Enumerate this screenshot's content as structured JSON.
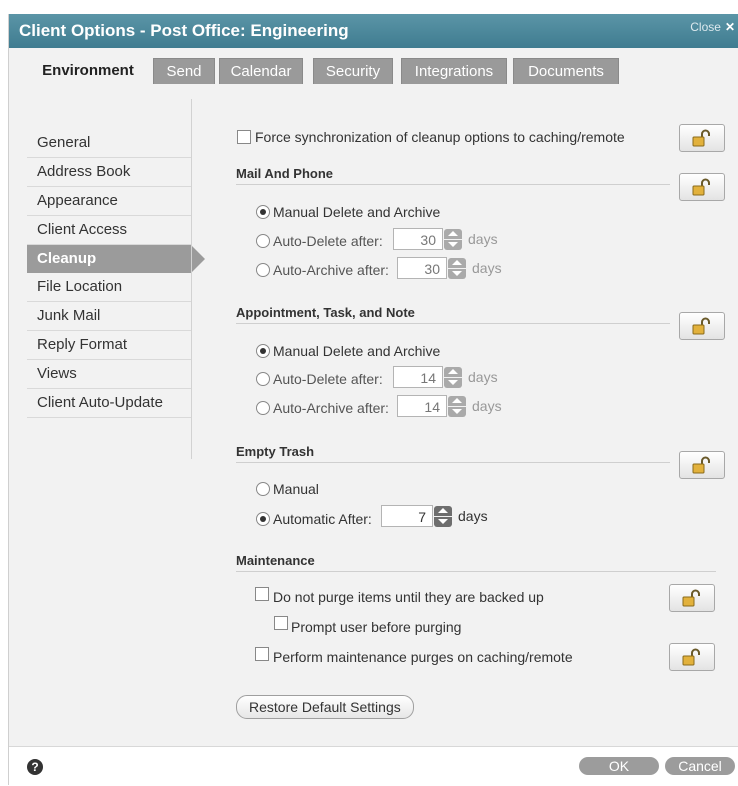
{
  "window": {
    "title": "Client Options - Post Office: Engineering",
    "close_label": "Close",
    "close_glyph": "✕"
  },
  "tabs": [
    {
      "label": "Environment",
      "active": true
    },
    {
      "label": "Send"
    },
    {
      "label": "Calendar"
    },
    {
      "label": "Security"
    },
    {
      "label": "Integrations"
    },
    {
      "label": "Documents"
    }
  ],
  "sidebar": {
    "items": [
      {
        "label": "General"
      },
      {
        "label": "Address Book"
      },
      {
        "label": "Appearance"
      },
      {
        "label": "Client Access"
      },
      {
        "label": "Cleanup",
        "active": true
      },
      {
        "label": "File Location"
      },
      {
        "label": "Junk Mail"
      },
      {
        "label": "Reply Format"
      },
      {
        "label": "Views"
      },
      {
        "label": "Client Auto-Update"
      }
    ]
  },
  "cleanup": {
    "force_sync": {
      "label": "Force synchronization of cleanup options to caching/remote",
      "checked": false
    },
    "mail_phone": {
      "heading": "Mail And Phone",
      "manual": {
        "label": "Manual Delete and Archive",
        "selected": true
      },
      "auto_delete": {
        "label": "Auto-Delete after:",
        "value": "30",
        "unit": "days",
        "selected": false
      },
      "auto_archive": {
        "label": "Auto-Archive after:",
        "value": "30",
        "unit": "days",
        "selected": false
      }
    },
    "appointment": {
      "heading": "Appointment, Task, and Note",
      "manual": {
        "label": "Manual Delete and Archive",
        "selected": true
      },
      "auto_delete": {
        "label": "Auto-Delete after:",
        "value": "14",
        "unit": "days",
        "selected": false
      },
      "auto_archive": {
        "label": "Auto-Archive after:",
        "value": "14",
        "unit": "days",
        "selected": false
      }
    },
    "trash": {
      "heading": "Empty Trash",
      "manual": {
        "label": "Manual",
        "selected": false
      },
      "automatic": {
        "label": "Automatic After:",
        "value": "7",
        "unit": "days",
        "selected": true
      }
    },
    "maintenance": {
      "heading": "Maintenance",
      "no_purge": {
        "label": "Do not purge items until they are backed up",
        "checked": false
      },
      "prompt": {
        "label": "Prompt user before purging",
        "checked": false
      },
      "perform": {
        "label": "Perform maintenance purges on caching/remote",
        "checked": false
      }
    },
    "restore_label": "Restore Default Settings"
  },
  "footer": {
    "help_glyph": "?",
    "ok_label": "OK",
    "cancel_label": "Cancel"
  },
  "icons": {
    "lock": "unlocked-padlock-icon",
    "help": "help-icon",
    "close": "close-icon"
  },
  "colors": {
    "titlebar": "#4a889b",
    "tab_inactive": "#9a9a9a",
    "nav_active": "#9b9b9b",
    "button_gray": "#9c9c9c"
  }
}
